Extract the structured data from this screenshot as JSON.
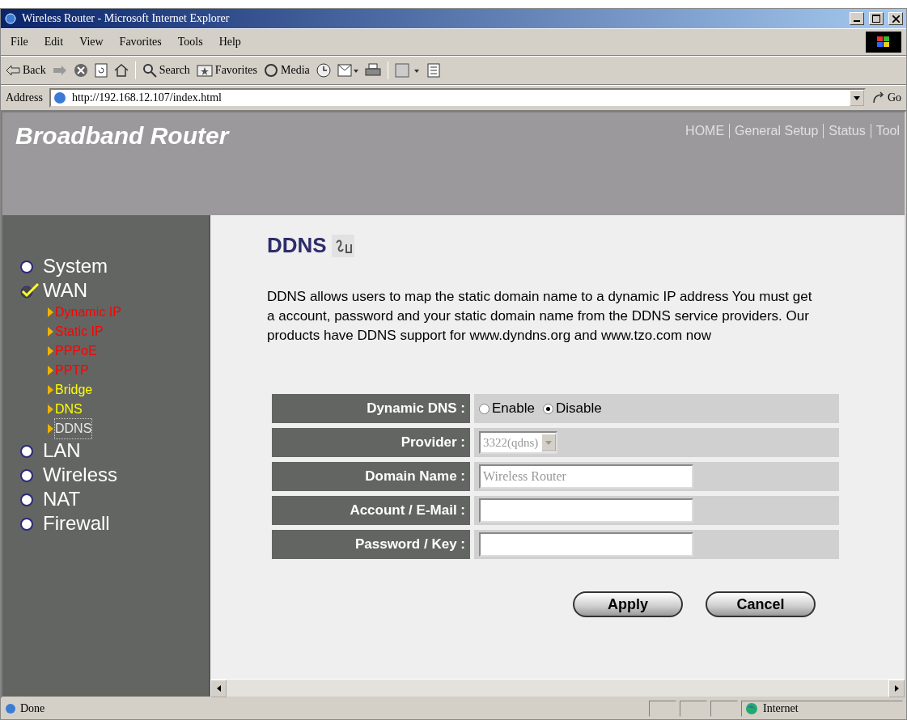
{
  "window": {
    "title": "Wireless Router - Microsoft Internet Explorer"
  },
  "menu": [
    "File",
    "Edit",
    "View",
    "Favorites",
    "Tools",
    "Help"
  ],
  "toolbar": [
    {
      "kind": "back",
      "label": "Back"
    },
    {
      "kind": "forward"
    },
    {
      "kind": "stop"
    },
    {
      "kind": "refresh"
    },
    {
      "kind": "home"
    },
    {
      "kind": "search",
      "label": "Search"
    },
    {
      "kind": "favorites",
      "label": "Favorites"
    },
    {
      "kind": "media",
      "label": "Media"
    },
    {
      "kind": "history"
    },
    {
      "kind": "mail"
    },
    {
      "kind": "print"
    },
    {
      "kind": "edit"
    },
    {
      "kind": "discuss"
    }
  ],
  "address": {
    "label": "Address",
    "value": "http://192.168.12.107/index.html",
    "go": "Go"
  },
  "page": {
    "brand": "Broadband Router",
    "nav": [
      "HOME",
      "General Setup",
      "Status",
      "Tool"
    ],
    "sidebar": [
      {
        "label": "System",
        "selected": false
      },
      {
        "label": "WAN",
        "selected": true,
        "children": [
          {
            "label": "Dynamic IP",
            "color": "#ff0000",
            "selected": false
          },
          {
            "label": "Static IP",
            "color": "#ff0000",
            "selected": false
          },
          {
            "label": "PPPoE",
            "color": "#ff0000",
            "selected": false
          },
          {
            "label": "PPTP",
            "color": "#ff0000",
            "selected": false
          },
          {
            "label": "Bridge",
            "color": "#ffff00",
            "selected": false
          },
          {
            "label": "DNS",
            "color": "#ffff00",
            "selected": false
          },
          {
            "label": "DDNS",
            "color": "#e6e6e6",
            "selected": true
          }
        ]
      },
      {
        "label": "LAN",
        "selected": false
      },
      {
        "label": "Wireless",
        "selected": false
      },
      {
        "label": "NAT",
        "selected": false
      },
      {
        "label": "Firewall",
        "selected": false
      }
    ],
    "heading": "DDNS",
    "description": "DDNS allows users to map the static domain name to a dynamic IP address You must get a account, password and your static domain name from the DDNS service providers. Our products have DDNS support for www.dyndns.org and www.tzo.com now",
    "form": [
      {
        "kind": "radio",
        "label": "Dynamic DNS :",
        "options": [
          {
            "label": "Enable",
            "selected": false
          },
          {
            "label": "Disable",
            "selected": true
          }
        ]
      },
      {
        "kind": "select",
        "label": "Provider :",
        "value": "3322(qdns)",
        "disabled": true
      },
      {
        "kind": "text",
        "label": "Domain Name :",
        "value": "Wireless Router",
        "disabled": true
      },
      {
        "kind": "text",
        "label": "Account / E-Mail :"
      },
      {
        "kind": "text",
        "label": "Password / Key :"
      }
    ],
    "buttons": [
      "Apply",
      "Cancel"
    ]
  },
  "status_bar": {
    "text": "Done",
    "zone": "Internet"
  }
}
